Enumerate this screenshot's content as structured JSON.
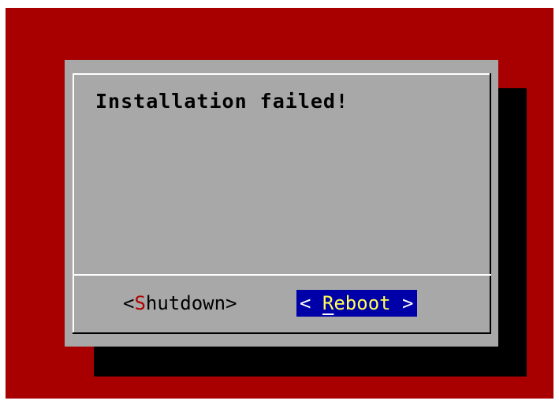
{
  "dialog": {
    "message": "Installation failed!"
  },
  "buttons": {
    "shutdown": {
      "open": "<",
      "hotkey": "S",
      "rest": "hutdown",
      "close": ">"
    },
    "reboot": {
      "open": "< ",
      "hotkey": "R",
      "rest": "eboot",
      "close": " >",
      "focused": true
    }
  },
  "colors": {
    "background": "#a80000",
    "dialog": "#a8a8a8",
    "shadow": "#000000",
    "focus_bg": "#0000a8",
    "focus_fg": "#ffff55",
    "hotkey": "#b00000"
  }
}
